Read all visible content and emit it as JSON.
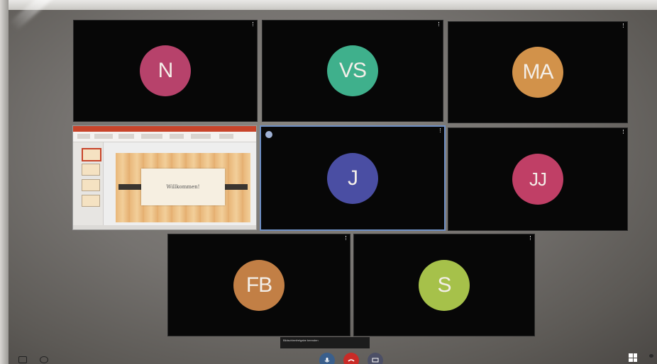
{
  "participants": [
    {
      "initials": "N",
      "color": "#b7426b",
      "label": "N"
    },
    {
      "initials": "VS",
      "color": "#3fb08c",
      "label": "VS"
    },
    {
      "initials": "MA",
      "color": "#d2924a",
      "label": "MA"
    },
    {
      "initials": "J",
      "color": "#4a4ea3",
      "label": "J",
      "speaking": true
    },
    {
      "initials": "JJ",
      "color": "#c03f66",
      "label": "JJ"
    },
    {
      "initials": "FB",
      "color": "#c27f45",
      "label": "FB"
    },
    {
      "initials": "S",
      "color": "#a6c14a",
      "label": "S"
    }
  ],
  "shared_screen": {
    "app_icon": "powerpoint-icon",
    "slide_text": "Willkommen!"
  },
  "controls": {
    "tooltip_text": "Bildschirmfreigabe beenden",
    "mic_icon": "microphone-icon",
    "end_icon": "hangup-icon",
    "share_icon": "share-screen-icon",
    "layout_icon": "grid-layout-icon",
    "people_icon": "people-icon"
  }
}
